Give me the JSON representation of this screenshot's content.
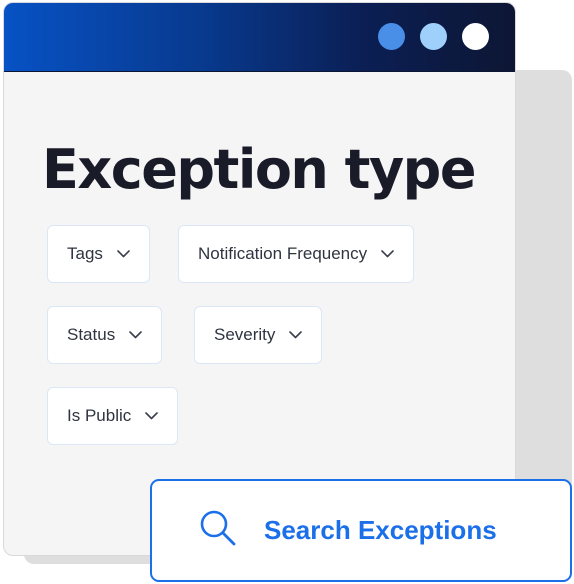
{
  "window": {
    "title_gradient_colors": [
      "#0752c5",
      "#0d1633"
    ],
    "controls": [
      {
        "name": "control-dot-blue",
        "color": "#4a8fe7"
      },
      {
        "name": "control-dot-light",
        "color": "#9fd0fb"
      },
      {
        "name": "control-dot-white",
        "color": "#ffffff"
      }
    ]
  },
  "heading": "Exception type",
  "filters": [
    {
      "label": "Tags",
      "icon": "chevron-down-icon"
    },
    {
      "label": "Notification Frequency",
      "icon": "chevron-down-icon"
    },
    {
      "label": "Status",
      "icon": "chevron-down-icon"
    },
    {
      "label": "Severity",
      "icon": "chevron-down-icon"
    },
    {
      "label": "Is Public",
      "icon": "chevron-down-icon"
    }
  ],
  "search": {
    "label": "Search Exceptions",
    "icon": "search-icon",
    "accent_color": "#1b6fe8"
  }
}
